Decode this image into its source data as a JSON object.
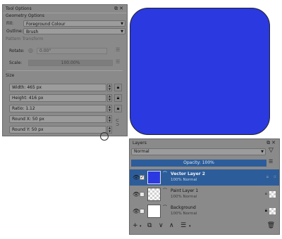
{
  "tool_options": {
    "title": "Tool Options",
    "section_geometry": "Geometry Options",
    "fill_label": "Fill:",
    "fill_value": "Foreground Colour",
    "outline_label": "Outline:",
    "outline_value": "Brush",
    "section_pattern": "Pattern Transform",
    "rotate_label": "Rotate:",
    "rotate_value": "0.00°",
    "scale_label": "Scale:",
    "scale_value": "100.00%",
    "scale_fraction": 1.0,
    "section_size": "Size",
    "width": "Width: 465 px",
    "height": "Height: 416 px",
    "ratio": "Ratio: 1.12",
    "round_x": "Round X: 50 px",
    "round_y": "Round Y: 50 px"
  },
  "canvas": {
    "shape_color": "#2b39e0"
  },
  "layers": {
    "title": "Layers",
    "blend_mode": "Normal",
    "opacity": "Opacity:  100%",
    "items": [
      {
        "name": "Vector Layer 2",
        "sub": "100% Normal",
        "selected": true
      },
      {
        "name": "Paint Layer 1",
        "sub": "100% Normal",
        "selected": false
      },
      {
        "name": "Background",
        "sub": "100% Normal",
        "selected": false
      }
    ]
  },
  "colors": {
    "panel_bg": "#8a8a8a",
    "selection": "#2c5d9a",
    "accent_blue": "#2b39e0"
  }
}
